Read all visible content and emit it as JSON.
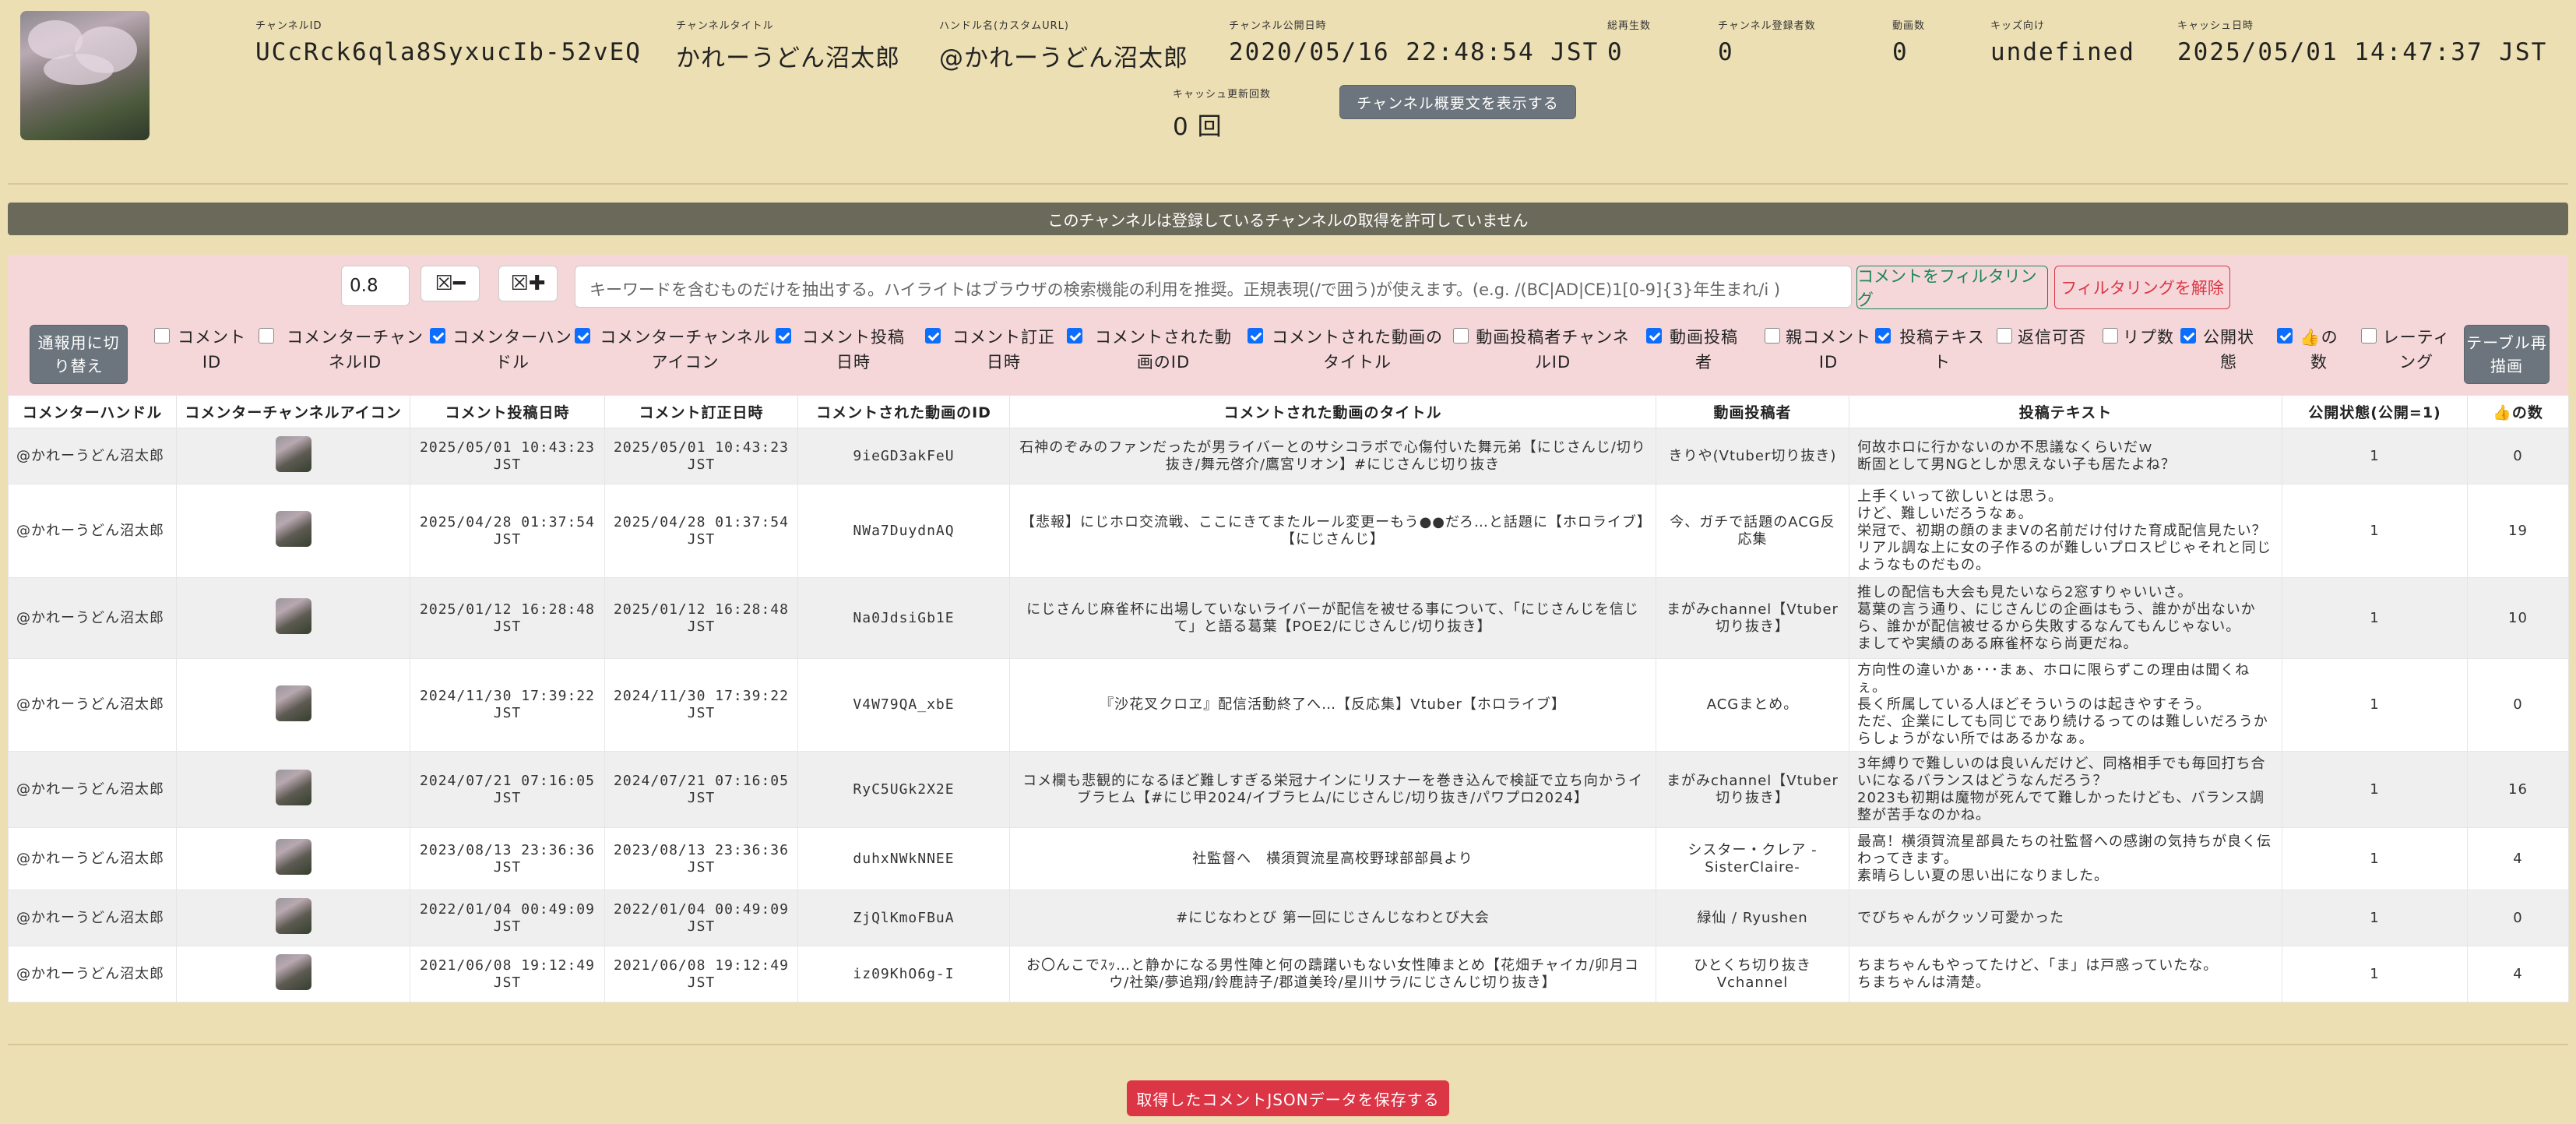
{
  "header": {
    "fields": [
      {
        "key": "チャンネルID",
        "value": "UCcRck6qla8SyxucIb-52vEQ"
      },
      {
        "key": "チャンネルタイトル",
        "value": "かれーうどん沼太郎"
      },
      {
        "key": "ハンドル名(カスタムURL)",
        "value": "@かれーうどん沼太郎"
      },
      {
        "key": "チャンネル公開日時",
        "value": "2020/05/16 22:48:54 JST"
      },
      {
        "key": "総再生数",
        "value": "0"
      },
      {
        "key": "チャンネル登録者数",
        "value": "0"
      },
      {
        "key": "動画数",
        "value": "0"
      },
      {
        "key": "キッズ向け",
        "value": "undefined"
      },
      {
        "key": "キャッシュ日時",
        "value": "2025/05/01 14:47:37 JST"
      },
      {
        "key": "キャッシュ更新回数",
        "value": "0 回"
      }
    ],
    "show_description_button": "チャンネル概要文を表示する"
  },
  "notice": "このチャンネルは登録しているチャンネルの取得を許可していません",
  "filter": {
    "threshold_value": "0.8",
    "minus_icon": "☒━",
    "plus_icon": "☒✚",
    "keyword_placeholder": "キーワードを含むものだけを抽出する。ハイライトはブラウザの検索機能の利用を推奨。正規表現(/で囲う)が使えます。(e.g. /(BC|AD|CE)1[0-9]{3}年生まれ/i )",
    "filter_button": "コメントをフィルタリング",
    "clear_button": "フィルタリングを解除",
    "toggle_button": "通報用に切り替え",
    "redraw_button": "テーブル再描画",
    "columns": [
      {
        "label": "コメントID",
        "checked": false
      },
      {
        "label": "コメンターチャンネルID",
        "checked": false
      },
      {
        "label": "コメンターハンドル",
        "checked": true
      },
      {
        "label": "コメンターチャンネルアイコン",
        "checked": true
      },
      {
        "label": "コメント投稿日時",
        "checked": true
      },
      {
        "label": "コメント訂正日時",
        "checked": true
      },
      {
        "label": "コメントされた動画のID",
        "checked": true
      },
      {
        "label": "コメントされた動画のタイトル",
        "checked": true
      },
      {
        "label": "動画投稿者チャンネルID",
        "checked": false
      },
      {
        "label": "動画投稿者",
        "checked": true
      },
      {
        "label": "親コメントID",
        "checked": false
      },
      {
        "label": "投稿テキスト",
        "checked": true
      },
      {
        "label": "返信可否",
        "checked": false
      },
      {
        "label": "リプ数",
        "checked": false
      },
      {
        "label": "公開状態",
        "checked": true
      },
      {
        "label": "👍の数",
        "checked": true
      },
      {
        "label": "レーティング",
        "checked": false
      }
    ]
  },
  "table": {
    "headers": [
      "コメンターハンドル",
      "コメンターチャンネルアイコン",
      "コメント投稿日時",
      "コメント訂正日時",
      "コメントされた動画のID",
      "コメントされた動画のタイトル",
      "動画投稿者",
      "投稿テキスト",
      "公開状態(公開=1)",
      "👍の数"
    ],
    "rows": [
      {
        "handle": "@かれーうどん沼太郎",
        "posted": "2025/05/01 10:43:23 JST",
        "edited": "2025/05/01 10:43:23 JST",
        "video_id": "9ieGD3akFeU",
        "title": "石神のぞみのファンだったが男ライバーとのサシコラボで心傷付いた舞元弟【にじさんじ/切り抜き/舞元啓介/鷹宮リオン】#にじさんじ切り抜き",
        "uploader": "きりや(Vtuber切り抜き)",
        "text": "何故ホロに行かないのか不思議なくらいだｗ\n断固として男NGとしか思えない子も居たよね？",
        "public": "1",
        "likes": "0"
      },
      {
        "handle": "@かれーうどん沼太郎",
        "posted": "2025/04/28 01:37:54 JST",
        "edited": "2025/04/28 01:37:54 JST",
        "video_id": "NWa7DuydnAQ",
        "title": "【悲報】にじホロ交流戦、ここにきてまたルール変更ーもう●●だろ…と話題に【ホロライブ】【にじさんじ】",
        "uploader": "今、ガチで話題のACG反応集",
        "text": "上手くいって欲しいとは思う。\nけど、難しいだろうなぁ。\n栄冠で、初期の顔のままVの名前だけ付けた育成配信見たい？\nリアル調な上に女の子作るのが難しいプロスピじゃそれと同じようなものだもの。",
        "public": "1",
        "likes": "19"
      },
      {
        "handle": "@かれーうどん沼太郎",
        "posted": "2025/01/12 16:28:48 JST",
        "edited": "2025/01/12 16:28:48 JST",
        "video_id": "Na0JdsiGb1E",
        "title": "にじさんじ麻雀杯に出場していないライバーが配信を被せる事について、「にじさんじを信じて」と語る葛葉【POE2/にじさんじ/切り抜き】",
        "uploader": "まがみchannel【Vtuber切り抜き】",
        "text": "推しの配信も大会も見たいなら2窓すりゃいいさ。\n葛葉の言う通り、にじさんじの企画はもう、誰かが出ないから、誰かが配信被せるから失敗するなんてもんじゃない。\nましてや実績のある麻雀杯なら尚更だね。",
        "public": "1",
        "likes": "10"
      },
      {
        "handle": "@かれーうどん沼太郎",
        "posted": "2024/11/30 17:39:22 JST",
        "edited": "2024/11/30 17:39:22 JST",
        "video_id": "V4W79QA_xbE",
        "title": "『沙花叉クロヱ』配信活動終了へ…【反応集】Vtuber【ホロライブ】",
        "uploader": "ACGまとめ。",
        "text": "方向性の違いかぁ･･･まぁ、ホロに限らずこの理由は聞くねぇ。\n長く所属している人ほどそういうのは起きやすそう。\nただ、企業にしても同じであり続けるってのは難しいだろうからしょうがない所ではあるかなぁ。",
        "public": "1",
        "likes": "0"
      },
      {
        "handle": "@かれーうどん沼太郎",
        "posted": "2024/07/21 07:16:05 JST",
        "edited": "2024/07/21 07:16:05 JST",
        "video_id": "RyC5UGk2X2E",
        "title": "コメ欄も悲観的になるほど難しすぎる栄冠ナインにリスナーを巻き込んで検証で立ち向かうイブラヒム【#にじ甲2024/イブラヒム/にじさんじ/切り抜き/パワプロ2024】",
        "uploader": "まがみchannel【Vtuber切り抜き】",
        "text": "3年縛りで難しいのは良いんだけど、同格相手でも毎回打ち合いになるバランスはどうなんだろう？\n2023も初期は魔物が死んでて難しかったけども、バランス調整が苦手なのかね。",
        "public": "1",
        "likes": "16"
      },
      {
        "handle": "@かれーうどん沼太郎",
        "posted": "2023/08/13 23:36:36 JST",
        "edited": "2023/08/13 23:36:36 JST",
        "video_id": "duhxNWkNNEE",
        "title": "社監督へ　横須賀流星高校野球部部員より",
        "uploader": "シスター・クレア -SisterClaire-",
        "text": "最高！横須賀流星部員たちの社監督への感謝の気持ちが良く伝わってきます。\n素晴らしい夏の思い出になりました。",
        "public": "1",
        "likes": "4"
      },
      {
        "handle": "@かれーうどん沼太郎",
        "posted": "2022/01/04 00:49:09 JST",
        "edited": "2022/01/04 00:49:09 JST",
        "video_id": "ZjQlKmoFBuA",
        "title": "#にじなわとび 第一回にじさんじなわとび大会",
        "uploader": "緑仙 / Ryushen",
        "text": "でびちゃんがクッソ可愛かった",
        "public": "1",
        "likes": "0"
      },
      {
        "handle": "@かれーうどん沼太郎",
        "posted": "2021/06/08 19:12:49 JST",
        "edited": "2021/06/08 19:12:49 JST",
        "video_id": "iz09KhO6g-I",
        "title": "お〇んこでｽｯ…と静かになる男性陣と何の躊躇いもない女性陣まとめ【花畑チャイカ/卯月コウ/社築/夢追翔/鈴鹿詩子/郡道美玲/星川サラ/にじさんじ切り抜き】",
        "uploader": "ひとくち切り抜きVchannel",
        "text": "ちまちゃんもやってたけど、「ま」は戸惑っていたな。\nちまちゃんは清楚。",
        "public": "1",
        "likes": "4"
      }
    ]
  },
  "save_button": "取得したコメントJSONデータを保存する"
}
